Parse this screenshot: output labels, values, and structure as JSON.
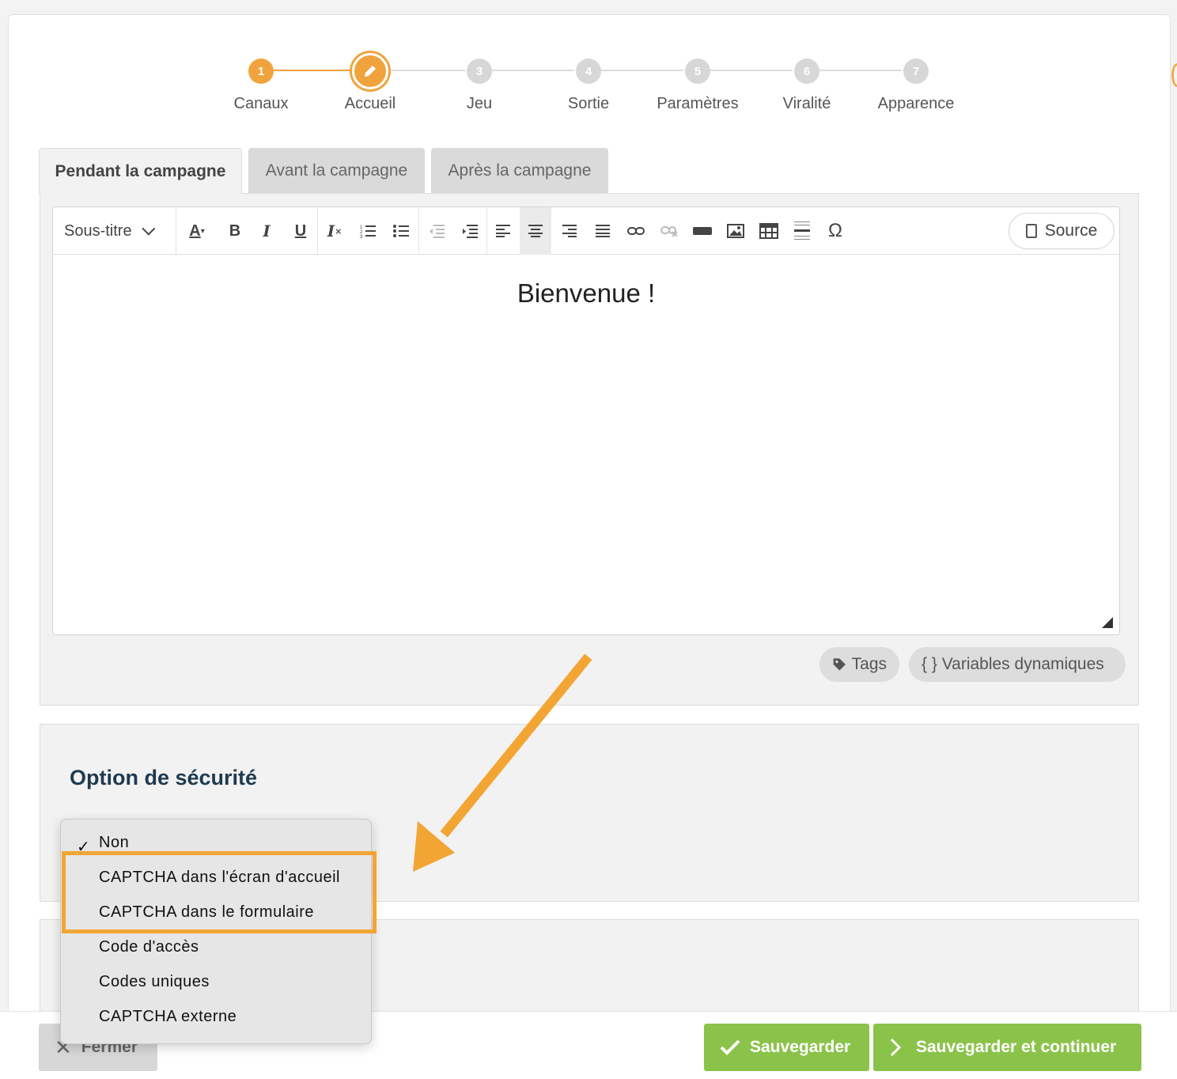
{
  "stepper": {
    "steps": [
      {
        "num": "1",
        "label": "Canaux"
      },
      {
        "num": "2",
        "label": "Accueil"
      },
      {
        "num": "3",
        "label": "Jeu"
      },
      {
        "num": "4",
        "label": "Sortie"
      },
      {
        "num": "5",
        "label": "Paramètres"
      },
      {
        "num": "6",
        "label": "Viralité"
      },
      {
        "num": "7",
        "label": "Apparence"
      }
    ],
    "current_step": 2,
    "accent_color": "#f0a33d"
  },
  "tabs": [
    {
      "label": "Pendant la campagne",
      "active": true
    },
    {
      "label": "Avant la campagne",
      "active": false
    },
    {
      "label": "Après la campagne",
      "active": false
    }
  ],
  "editor": {
    "format_select": "Sous-titre",
    "source_label": "Source",
    "content_heading": "Bienvenue !",
    "toolbar_icons": [
      "text-color-icon",
      "bold-icon",
      "italic-icon",
      "underline-icon",
      "clear-format-icon",
      "numbered-list-icon",
      "bullet-list-icon",
      "outdent-icon",
      "indent-icon",
      "align-left-icon",
      "align-center-icon",
      "align-right-icon",
      "justify-icon",
      "link-icon",
      "unlink-icon",
      "button-icon",
      "image-icon",
      "table-icon",
      "horizontal-rule-icon",
      "special-char-icon"
    ]
  },
  "pills": {
    "tags": "Tags",
    "variables": "{ } Variables dynamiques"
  },
  "security": {
    "title": "Option de sécurité",
    "options": [
      "Non",
      "CAPTCHA dans l'écran d'accueil",
      "CAPTCHA dans le formulaire",
      "Code d'accès",
      "Codes uniques",
      "CAPTCHA externe"
    ],
    "selected": "Non",
    "highlight_color": "#f3a534"
  },
  "footer": {
    "close_label": "Fermer",
    "save_label": "Sauvegarder",
    "save_continue_label": "Sauvegarder et continuer",
    "button_color": "#8bc34a"
  }
}
